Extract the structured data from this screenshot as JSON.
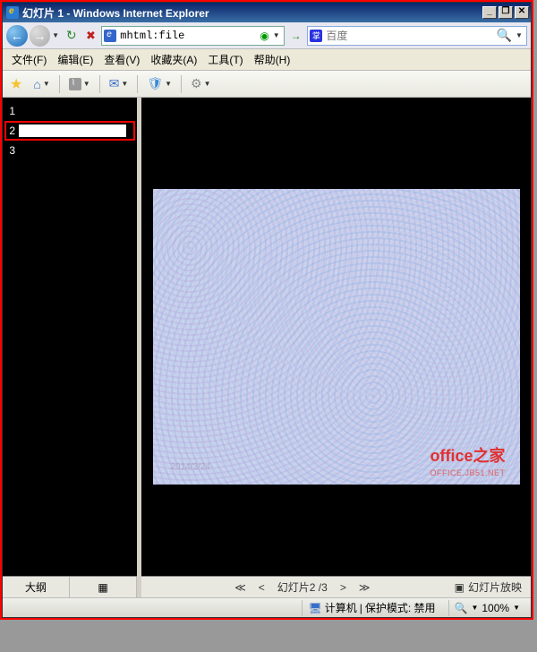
{
  "title": "幻灯片 1 - Windows Internet Explorer",
  "window_buttons": {
    "min": "_",
    "restore": "❐",
    "close": "✕"
  },
  "nav": {
    "address": "mhtml:file",
    "search_engine": "百度",
    "search_placeholder": "百度"
  },
  "menu": {
    "file": "文件(F)",
    "edit": "编辑(E)",
    "view": "查看(V)",
    "favorites": "收藏夹(A)",
    "tools": "工具(T)",
    "help": "帮助(H)"
  },
  "left": {
    "slides": [
      "1",
      "2",
      "3"
    ],
    "selected_index": 1,
    "tab_outline": "大纲"
  },
  "slide": {
    "date_watermark": "2014/3/24",
    "logo": "office之家",
    "logo_sub": "OFFICE.JB51.NET"
  },
  "slide_nav": {
    "counter": "幻灯片2 /3",
    "slideshow": "幻灯片放映"
  },
  "status": {
    "zone": "计算机",
    "protected": "保护模式: 禁用",
    "zoom": "100%"
  }
}
